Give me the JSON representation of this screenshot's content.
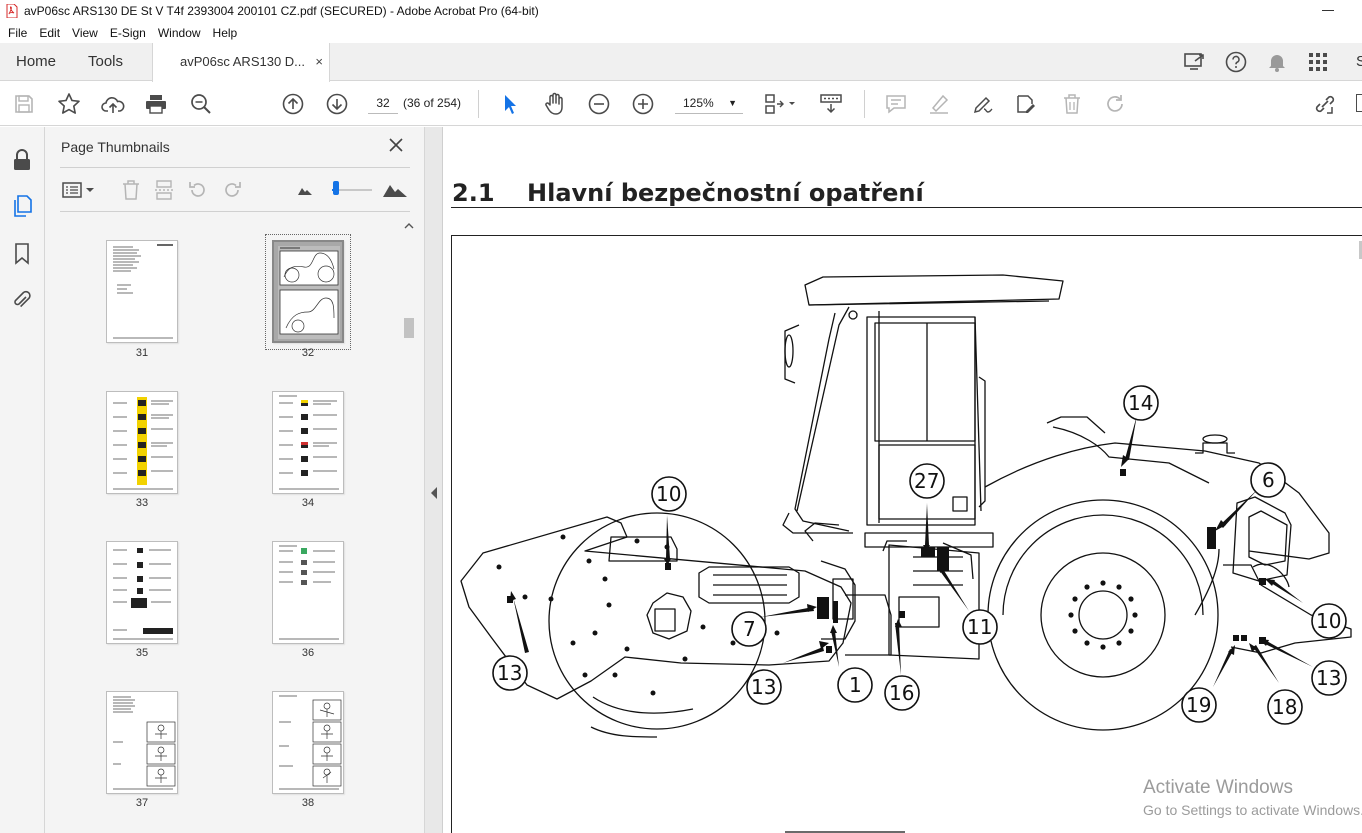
{
  "window": {
    "title": "avP06sc ARS130 DE St V T4f 2393004 200101 CZ.pdf (SECURED) - Adobe Acrobat Pro (64-bit)"
  },
  "menu": [
    "File",
    "Edit",
    "View",
    "E-Sign",
    "Window",
    "Help"
  ],
  "tabs": {
    "home": "Home",
    "tools": "Tools",
    "document": "avP06sc ARS130 D...",
    "close": "×",
    "partial_right": "S"
  },
  "toolbar": {
    "page_number": "32",
    "page_count": "(36 of 254)",
    "zoom": "125%"
  },
  "panel": {
    "title": "Page Thumbnails",
    "close": "×",
    "thumbnails": [
      {
        "label": "31"
      },
      {
        "label": "32"
      },
      {
        "label": "33"
      },
      {
        "label": "34"
      },
      {
        "label": "35"
      },
      {
        "label": "36"
      },
      {
        "label": "37"
      },
      {
        "label": "38"
      }
    ]
  },
  "document": {
    "section_number": "2.1",
    "section_title": "Hlavní bezpečnostní opatření",
    "callouts": [
      "14",
      "10",
      "27",
      "6",
      "7",
      "11",
      "10",
      "13",
      "13",
      "1",
      "16",
      "19",
      "18",
      "13"
    ]
  },
  "watermark": {
    "line1": "Activate Windows",
    "line2": "Go to Settings to activate Windows."
  },
  "colors": {
    "accent": "#1473e6",
    "acrobat_red": "#e02020",
    "toolbar_icon": "#4b4b4b",
    "disabled_icon": "#b5b5b5"
  }
}
